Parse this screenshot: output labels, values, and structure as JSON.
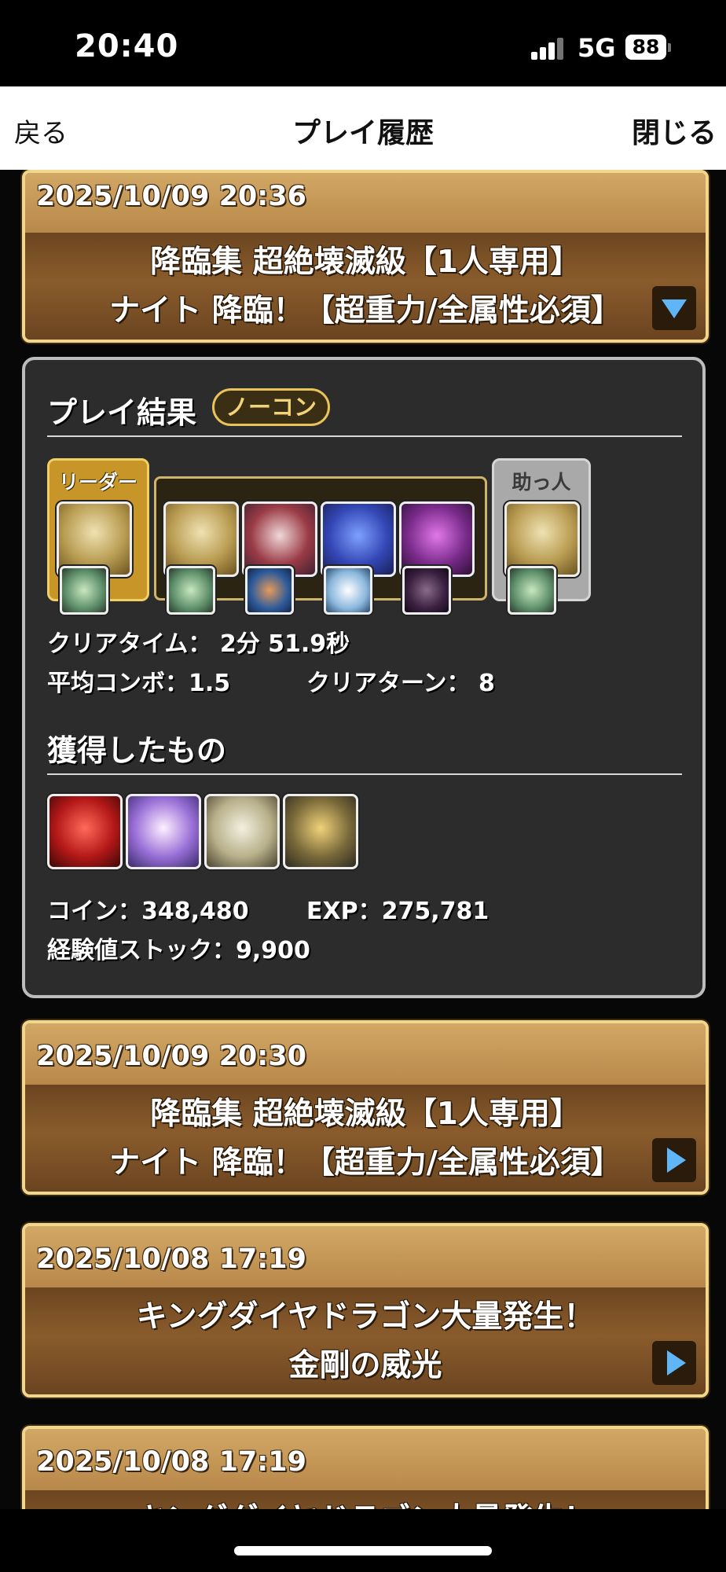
{
  "status_bar": {
    "time": "20:40",
    "network": "5G",
    "battery": "88"
  },
  "nav": {
    "back": "戻る",
    "title": "プレイ履歴",
    "close": "閉じる"
  },
  "entries": [
    {
      "datetime": "2025/10/09 20:36",
      "line1": "降臨集 超絶壊滅級【1人専用】",
      "line2": "ナイト 降臨！【超重力/全属性必須】",
      "toggle": "expanded"
    },
    {
      "datetime": "2025/10/09 20:30",
      "line1": "降臨集 超絶壊滅級【1人専用】",
      "line2": "ナイト 降臨！【超重力/全属性必須】",
      "toggle": "collapsed"
    },
    {
      "datetime": "2025/10/08 17:19",
      "line1": "キングダイヤドラゴン大量発生！",
      "line2": "金剛の威光",
      "toggle": "collapsed"
    },
    {
      "datetime": "2025/10/08 17:19",
      "line1": "キングダイヤドラゴン大量発生！",
      "line2": "",
      "toggle": "collapsed"
    }
  ],
  "result": {
    "header": "プレイ結果",
    "badge": "ノーコン",
    "leader_label": "リーダー",
    "helper_label": "助っ人",
    "team": [
      "gold-armor-monster",
      "purple-hair-girl-monster",
      "blue-rabbit-monster",
      "thanos-monster"
    ],
    "clear_time": "クリアタイム： 2分 51.9秒",
    "avg_combo": "平均コンボ：1.5",
    "clear_turn": "クリアターン： 8",
    "obtained_header": "獲得したもの",
    "obtained": [
      "red-ranger-monster",
      "rainbow-cat-monster",
      "white-dragon-monster",
      "scroll-item"
    ],
    "coin": "コイン：348,480",
    "exp": "EXP：275,781",
    "exp_stock": "経験値ストック：9,900"
  }
}
